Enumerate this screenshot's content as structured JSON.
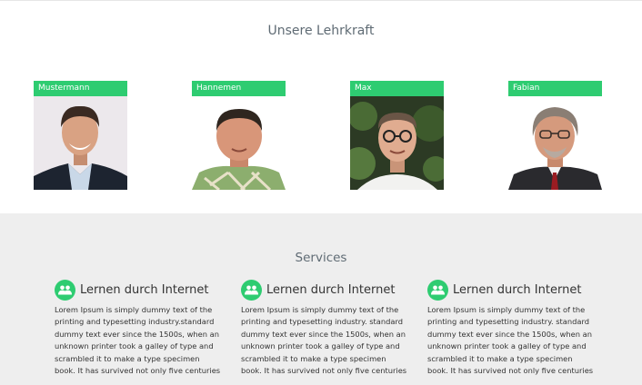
{
  "team": {
    "title": "Unsere Lehrkraft",
    "members": [
      {
        "name": "Mustermann"
      },
      {
        "name": "Hannemen"
      },
      {
        "name": "Max"
      },
      {
        "name": "Fabian"
      }
    ]
  },
  "services": {
    "title": "Services",
    "items": [
      {
        "icon": "users-icon",
        "title": "Lernen durch Internet",
        "text": "Lorem Ipsum is simply dummy text of the printing and typesetting industry.standard dummy text ever since the 1500s, when an unknown printer took a galley of type and scrambled it to make a type specimen book. It has survived not only five centuries"
      },
      {
        "icon": "users-icon",
        "title": "Lernen durch Internet",
        "text": "Lorem Ipsum is simply dummy text of the printing and typesetting industry. standard dummy text ever since the 1500s, when an unknown printer took a galley of type and scrambled it to make a type specimen book. It has survived not only five centuries"
      },
      {
        "icon": "users-icon",
        "title": "Lernen durch Internet",
        "text": "Lorem Ipsum is simply dummy text of the printing and typesetting industry. standard dummy text ever since the 1500s, when an unknown printer took a galley of type and scrambled it to make a type specimen book. It has survived not only five centuries"
      }
    ]
  },
  "colors": {
    "accent": "#2ecc71",
    "section_bg": "#eeeeee",
    "heading": "#5f6b74"
  }
}
